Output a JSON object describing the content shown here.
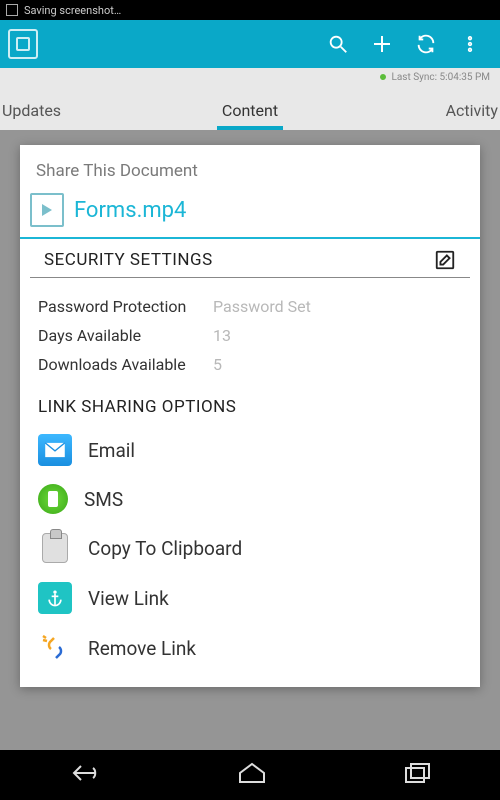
{
  "statusBar": {
    "text": "Saving screenshot…"
  },
  "syncRow": {
    "text": "Last Sync: 5:04:35 PM"
  },
  "tabs": {
    "left": "Updates",
    "center": "Content",
    "right": "Activity"
  },
  "dialog": {
    "title": "Share This Document",
    "fileName": "Forms.mp4",
    "securityHeader": "SECURITY SETTINGS",
    "security": {
      "passwordLabel": "Password Protection",
      "passwordValue": "Password Set",
      "daysLabel": "Days Available",
      "daysValue": "13",
      "downloadsLabel": "Downloads Available",
      "downloadsValue": "5"
    },
    "optionsHeader": "LINK SHARING OPTIONS",
    "options": {
      "email": "Email",
      "sms": "SMS",
      "copy": "Copy To Clipboard",
      "view": "View Link",
      "remove": "Remove Link"
    }
  }
}
